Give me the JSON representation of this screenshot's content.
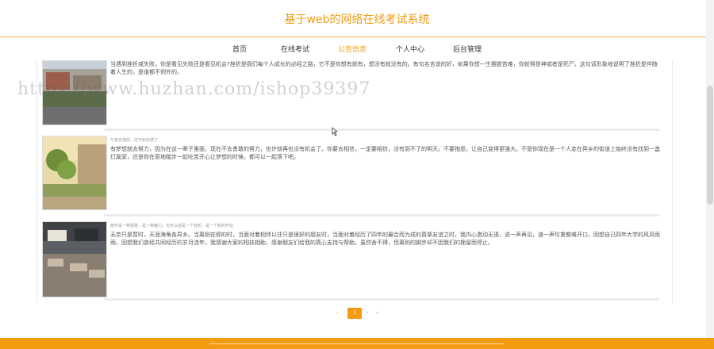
{
  "site": {
    "title": "基于web的网络在线考试系统"
  },
  "nav": {
    "items": [
      {
        "label": "首页",
        "active": false
      },
      {
        "label": "在线考试",
        "active": false
      },
      {
        "label": "公告信息",
        "active": true
      },
      {
        "label": "个人中心",
        "active": false
      },
      {
        "label": "后台管理",
        "active": false
      }
    ]
  },
  "announcements": [
    {
      "meta": "",
      "summary": "当遇到挫折或失败，你是看见失败还是看见机会?挫折是我们每个人成长的必经之路，它不是你想有就有，想没有就没有的。有句名言说的好，如果你想一生摆脱苦难，你就得是神或者是死尸。这句话形象地说明了挫折是伴随着人生的，是谁都不例外的。"
    },
    {
      "meta": "与其去抱怨，还不如去做了",
      "summary": "有梦想就去努力，因为在这一辈子里面，现在不去勇敢的努力，也许就再也没有机会了。你要去相信，一定要相信，没有到不了的明天。不要抱怨，让自己变得更强大。不管你现在是一个人走在异乡的街道上始终没有找到一盏灯属家，还是你在原地踏步一起吃苦开心让梦想的时候，都可以一起落下吧。"
    },
    {
      "meta": "离开是一种勇敢，是一种魔力，也可以说是一个转折，是一个新的开始",
      "summary": "无奈只是暂时，天涯海角各异乡。当离别在即的时，当面对着相伴以往只是很好的朋友时，当面对着经历了四年的最合而为成的真挚友谊之时，我内心激动无语，说一声再见，道一声珍重都难开口。回想自己四年大学的风风雨雨，回想我们曾经共同经历的岁月流年，我感谢大家的相扶相助，感谢朋友们给我的真心支持与帮助。虽然舍不得，但离别的脚步却不因我们的挽留而停止。"
    }
  ],
  "pagination": {
    "prev": "‹",
    "current": "1",
    "next": "›",
    "last": "»"
  },
  "watermark": "https://www.huzhan.com/ishop39397"
}
